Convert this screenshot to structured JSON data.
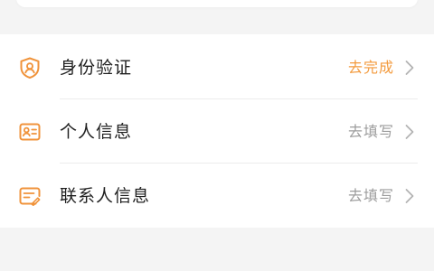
{
  "colors": {
    "accent": "#f39a3c",
    "icon": "#f0933b",
    "label": "#1f1f1f",
    "muted": "#9c9c9c",
    "background": "#f4f4f4",
    "panel": "#ffffff"
  },
  "items": [
    {
      "label": "身份验证",
      "action": "去完成",
      "icon": "shield-user-icon",
      "action_color": "#f39a3c"
    },
    {
      "label": "个人信息",
      "action": "去填写",
      "icon": "id-card-icon",
      "action_color": "#9c9c9c"
    },
    {
      "label": "联系人信息",
      "action": "去填写",
      "icon": "contact-form-icon",
      "action_color": "#9c9c9c"
    }
  ]
}
